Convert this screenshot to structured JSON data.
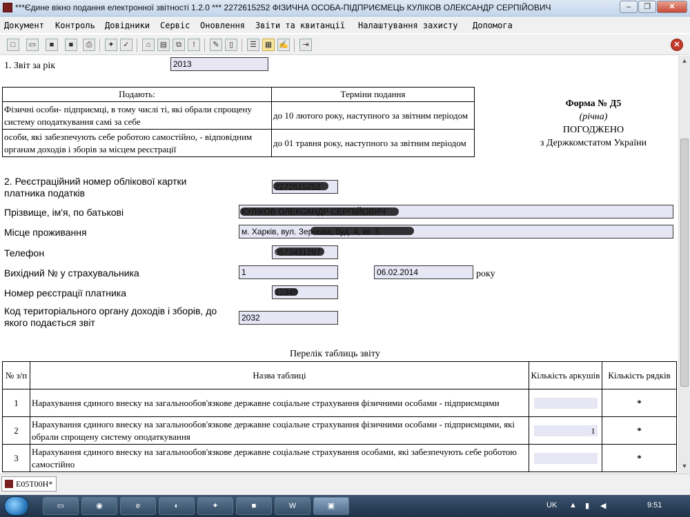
{
  "window": {
    "title": "***Єдине вікно подання електронної звітності 1.2.0 *** 2272615252 ФІЗИЧНА ОСОБА-ПІДПРИЄМЕЦЬ КУЛІКОВ ОЛЕКСАНДР СЕРПІЙОВИЧ",
    "minimize": "‒",
    "maximize": "❐",
    "close": "✕"
  },
  "menu": [
    "Документ",
    "Контроль",
    "Довідники",
    "Сервіс",
    "Оновлення",
    "Звіти та квитанції",
    "Налаштування захисту",
    "Допомога"
  ],
  "toolbar": {
    "icons": [
      "new-doc-icon",
      "open-folder-icon",
      "save-icon",
      "save-all-icon",
      "print-icon",
      "tools-icon",
      "check-icon",
      "home-icon",
      "book-icon",
      "copy-icon",
      "error-check-icon",
      "edit-pen-icon",
      "clear-icon",
      "properties-icon",
      "view-icon",
      "sign-icon",
      "exit-icon"
    ],
    "close_label": "✕"
  },
  "form": {
    "year_label": "1. Звіт за рік",
    "year_value": "2013",
    "submit_table": {
      "header_who": "Подають:",
      "header_when": "Терміни подання",
      "rows": [
        {
          "who": "Фізичні особи- підприємці, в тому числі ті, які обрали спрощену систему оподаткування самі за себе",
          "when": "до 10 лютого року, наступного за звітним періодом"
        },
        {
          "who": "особи, які забезпечують себе роботою самостійно, - відповідним органам доходів і зборів за місцем реєстрації",
          "when": "до 01 травня року, наступного за звітним періодом"
        }
      ]
    },
    "form_no": "Форма № Д5",
    "form_period": "(річна)",
    "approved": "ПОГОДЖЕНО",
    "approved_by": "з Держкомстатом України",
    "reg_label": "2. Реєстраційний номер облікової картки платника податків",
    "reg_value": "2272615252",
    "name_label": "Прізвище, ім'я, по батькові",
    "name_value": "КУЛІКОВ ОЛЕКСАНДР СЕРПІЙОВИЧ",
    "address_label": "Місце проживання",
    "address_value": "м. Харків, вул. Зернова, буд. 4, кв. 5",
    "phone_label": "Телефон",
    "phone_value": "0573431297",
    "outgoing_label": "Вихідний № у страхувальника",
    "outgoing_value": "1",
    "outgoing_date": "06.02.2014",
    "year_word": "року",
    "insurer_label": "Номер реєстрації платника",
    "insurer_value": "12345",
    "office_label": "Код територіального органу доходів і зборів, до якого подається звіт",
    "office_value": "2032"
  },
  "tables_list": {
    "caption": "Перелік таблиць звіту",
    "col_no": "№ з/п",
    "col_name": "Назва таблиці",
    "col_sheets": "Кількість аркушів",
    "col_rows": "Кількість рядків",
    "rows": [
      {
        "no": "1",
        "name": "Нарахування єдиного внеску на загальнообов'язкове державне соціальне страхування фізичними особами - підприємцями",
        "sheets": "",
        "rows": "*"
      },
      {
        "no": "2",
        "name": "Нарахування єдиного внеску на загальнообов'язкове державне соціальне страхування фізичними особами - підприємцями, які обрали спрощену систему оподаткування",
        "sheets": "1",
        "rows": "*"
      },
      {
        "no": "3",
        "name": "Нарахування єдиного внеску на загальнообов'язкове державне соціальне страхування особами, які забезпечують себе роботою самостійно",
        "sheets": "",
        "rows": "*"
      }
    ]
  },
  "status": {
    "doc_tab": "E05T00H*"
  },
  "taskbar": {
    "apps": [
      "explorer-icon",
      "chrome-icon",
      "ie-icon",
      "firefox-icon",
      "tool-icon",
      "save-icon",
      "word-icon",
      "report-app-icon"
    ],
    "lang": "UK",
    "time": "9:51"
  }
}
